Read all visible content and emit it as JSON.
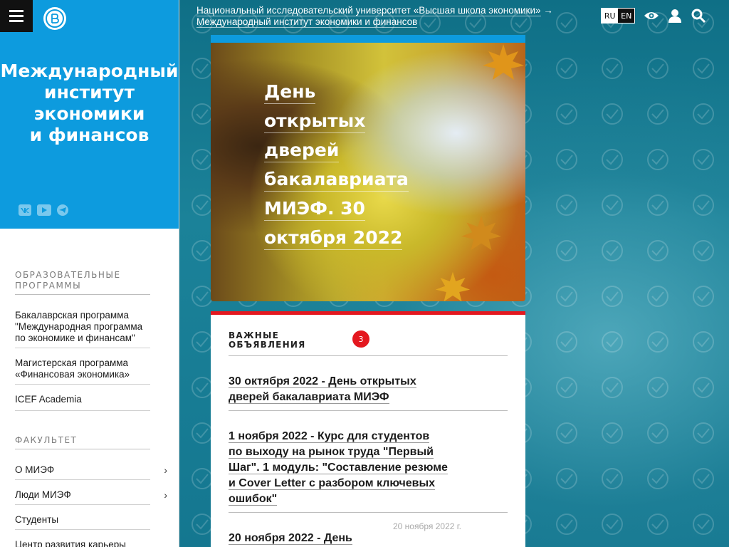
{
  "header": {
    "breadcrumb": {
      "parent": "Национальный исследовательский университет «Высшая школа экономики»",
      "arrow": "→",
      "current": "Международный институт экономики и финансов"
    },
    "lang": {
      "ru": "RU",
      "en": "EN"
    }
  },
  "sidebar": {
    "title_lines": [
      "Международный",
      "институт",
      "экономики",
      "и финансов"
    ],
    "sections": [
      {
        "header": "Образовательные программы",
        "items": [
          {
            "label": "Бакалаврская программа \"Международная программа по экономике и финансам\""
          },
          {
            "label": "Магистерская программа «Финансовая экономика»"
          },
          {
            "label": "ICEF Academia"
          }
        ]
      },
      {
        "header": "Факультет",
        "items": [
          {
            "label": "О МИЭФ",
            "chevron": "›"
          },
          {
            "label": "Люди МИЭФ",
            "chevron": "›"
          },
          {
            "label": "Студенты"
          },
          {
            "label": "Центр развития карьеры"
          }
        ]
      }
    ]
  },
  "banner": {
    "title_lines": [
      "День открытых",
      "дверей",
      "бакалавриата",
      "МИЭФ. 30",
      "октября 2022"
    ]
  },
  "announcements": {
    "header_lines": [
      "Важные",
      "объявления"
    ],
    "count": "3",
    "items": [
      {
        "title_lines": [
          "30 октября 2022 - День открытых",
          "дверей бакалавриата МИЭФ"
        ]
      },
      {
        "title_lines": [
          "1 ноября 2022 - Курс для студентов",
          "по выходу на рынок труда \"Первый",
          "Шаг\". 1 модуль: \"Составление резюме",
          "и Cover Letter с разбором ключевых",
          "ошибок\""
        ]
      },
      {
        "title_lines": [
          "20 ноября 2022 - День"
        ],
        "date": "20 ноября 2022 г."
      }
    ]
  },
  "colors": {
    "sidebar_blue": "#0d9bde",
    "accent_red": "#e4181f",
    "background_teal": "#1f7f96"
  }
}
